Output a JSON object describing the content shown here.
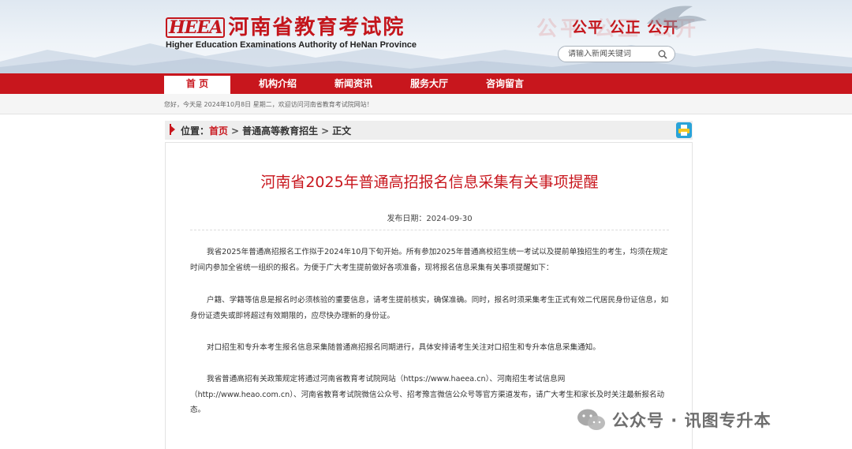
{
  "header": {
    "logo_mark": "HEEA",
    "org_name_cn": "河南省教育考试院",
    "org_name_en": "Higher Education Examinations Authority of HeNan Province",
    "slogan": "公平 公正 公开",
    "search": {
      "placeholder": "请输入新闻关键词"
    }
  },
  "nav": {
    "items": [
      {
        "label": "首 页",
        "active": true
      },
      {
        "label": "机构介绍"
      },
      {
        "label": "新闻资讯"
      },
      {
        "label": "服务大厅"
      },
      {
        "label": "咨询留言"
      }
    ]
  },
  "welcome": {
    "text": "您好，今天是 2024年10月8日 星期二，欢迎访问河南省教育考试院网站！"
  },
  "breadcrumb": {
    "prefix": "位置：",
    "items": [
      "首页",
      "普通高等教育招生",
      "正文"
    ],
    "separator": ">"
  },
  "article": {
    "title": "河南省2025年普通高招报名信息采集有关事项提醒",
    "date": "发布日期：2024-09-30",
    "paragraphs": [
      "我省2025年普通高招报名工作拟于2024年10月下旬开始。所有参加2025年普通高校招生统一考试以及提前单独招生的考生，均须在规定时间内参加全省统一组织的报名。为便于广大考生提前做好各项准备，现将报名信息采集有关事项提醒如下：",
      "户籍、学籍等信息是报名时必须核验的重要信息，请考生提前核实，确保准确。同时，报名时须采集考生正式有效二代居民身份证信息，如身份证遗失或即将超过有效期限的，应尽快办理新的身份证。",
      "对口招生和专升本考生报名信息采集随普通高招报名同期进行，具体安排请考生关注对口招生和专升本信息采集通知。",
      "我省普通高招有关政策规定将通过河南省教育考试院网站（https://www.haeea.cn）、河南招生考试信息网（http://www.heao.com.cn）、河南省教育考试院微信公众号、招考豫言微信公众号等官方渠道发布，请广大考生和家长及时关注最新报名动态。"
    ]
  },
  "watermark": {
    "text": "公众号 · 讯图专升本"
  },
  "colors": {
    "brand_red": "#c8161d",
    "nav_red": "#c8161d"
  }
}
